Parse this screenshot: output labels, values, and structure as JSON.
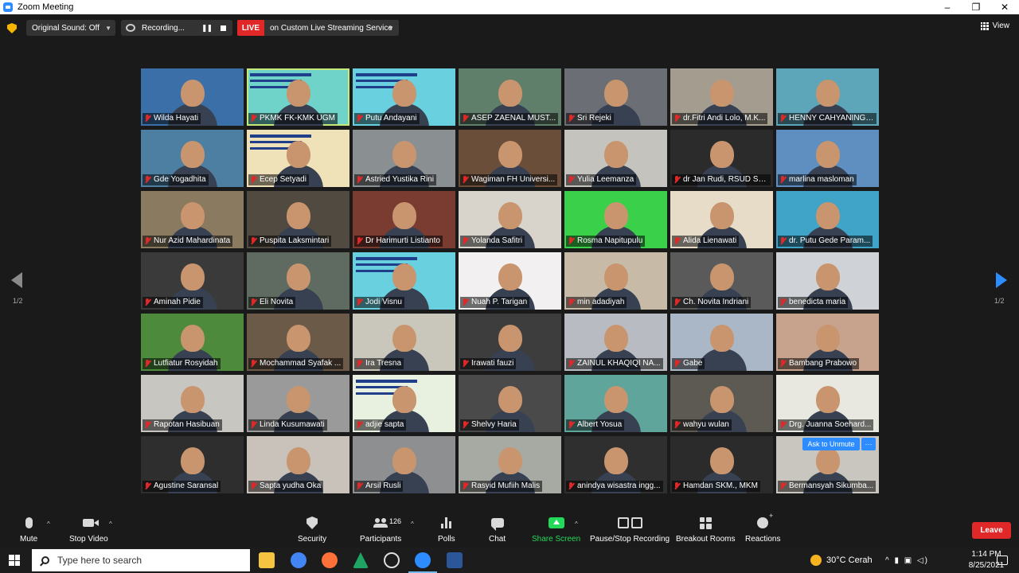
{
  "window": {
    "title": "Zoom Meeting",
    "minimize": "–",
    "restore": "❐",
    "close": "✕"
  },
  "topbar": {
    "original_sound": "Original Sound: Off",
    "recording": "Recording...",
    "live_badge": "LIVE",
    "live_service": "on Custom Live Streaming Service",
    "view": "View"
  },
  "gallery": {
    "page_left": "1/2",
    "page_right": "1/2",
    "ask_to_unmute": "Ask to Unmute",
    "more": "···",
    "participants": [
      {
        "name": "Wilda Hayati",
        "bg": "#3a6fa8"
      },
      {
        "name": "PKMK FK-KMK UGM",
        "bg": "#6fd3c9"
      },
      {
        "name": "Putu Andayani",
        "bg": "#69d0e0"
      },
      {
        "name": "ASEP ZAENAL MUST...",
        "bg": "#5f7f6a"
      },
      {
        "name": "Sri Rejeki",
        "bg": "#6b6f75"
      },
      {
        "name": "dr.Fitri Andi Lolo, M.K...",
        "bg": "#a39c8f"
      },
      {
        "name": "HENNY CAHYANINGS...",
        "bg": "#5da5b8"
      },
      {
        "name": "Gde Yogadhita",
        "bg": "#4d7fa3"
      },
      {
        "name": "Ecep Setyadi",
        "bg": "#f0e2b8"
      },
      {
        "name": "Astried Yustika Rini",
        "bg": "#8a8f92"
      },
      {
        "name": "Wagiman FH Universi...",
        "bg": "#6a4e3a"
      },
      {
        "name": "Yulia Leemanza",
        "bg": "#c5c3be"
      },
      {
        "name": "dr Jan Rudi, RSUD Su...",
        "bg": "#2b2b2b"
      },
      {
        "name": "marlina masloman",
        "bg": "#5e8fc0"
      },
      {
        "name": "Nur Azid Mahardinata",
        "bg": "#8a7a60"
      },
      {
        "name": "Puspita Laksmintari",
        "bg": "#514a40"
      },
      {
        "name": "Dr Harimurti Listianto",
        "bg": "#7a3b30"
      },
      {
        "name": "Yolanda Safitri",
        "bg": "#d8d4cc"
      },
      {
        "name": "Rosma Napitupulu",
        "bg": "#3bd04a"
      },
      {
        "name": "Alida Lienawati",
        "bg": "#e6dcc8"
      },
      {
        "name": "dr. Putu Gede Param...",
        "bg": "#3fa4c8"
      },
      {
        "name": "Aminah Pidie",
        "bg": "#3a3a3a"
      },
      {
        "name": "Eli Novita",
        "bg": "#5f6a60"
      },
      {
        "name": "Jodi Visnu",
        "bg": "#69d0e0"
      },
      {
        "name": "Nuah P. Tarigan",
        "bg": "#f2f0f0"
      },
      {
        "name": "min adadiyah",
        "bg": "#c7bba8"
      },
      {
        "name": "Ch. Novita Indriani",
        "bg": "#5a5a5a"
      },
      {
        "name": "benedicta maria",
        "bg": "#cfd3d8"
      },
      {
        "name": "Lutfiatur Rosyidah",
        "bg": "#4e8a3c"
      },
      {
        "name": "Mochammad Syafak ...",
        "bg": "#6c5a48"
      },
      {
        "name": "Ira Tresna",
        "bg": "#c9c7bc"
      },
      {
        "name": "Irawati fauzi",
        "bg": "#3d3d3d"
      },
      {
        "name": "ZAINUL KHAQIQI NA...",
        "bg": "#b8bcc2"
      },
      {
        "name": "Gabe",
        "bg": "#aab7c6"
      },
      {
        "name": "Bambang Prabowo",
        "bg": "#c7a28c"
      },
      {
        "name": "Rapotan Hasibuan",
        "bg": "#c8c6c0"
      },
      {
        "name": "Linda Kusumawati",
        "bg": "#9a9a9a"
      },
      {
        "name": "adjie sapta",
        "bg": "#e8f0e0"
      },
      {
        "name": "Shelvy Haria",
        "bg": "#4a4a4a"
      },
      {
        "name": "Albert Yosua",
        "bg": "#5fa59c"
      },
      {
        "name": "wahyu wulan",
        "bg": "#5c5a52"
      },
      {
        "name": "Drg. Juanna Soehard...",
        "bg": "#e8e8e0"
      },
      {
        "name": "Agustine Saransal",
        "bg": "#2e2e2e"
      },
      {
        "name": "Sapta yudha Oka",
        "bg": "#c8c2bb"
      },
      {
        "name": "Arsil Rusli",
        "bg": "#8d8f90"
      },
      {
        "name": "Rasyid Mufiih Malis",
        "bg": "#a7a9a3"
      },
      {
        "name": "anindya wisastra ingg...",
        "bg": "#2f2f2f"
      },
      {
        "name": "Hamdan SKM., MKM",
        "bg": "#2b2b2b"
      },
      {
        "name": "Bermansyah Sikumba...",
        "bg": "#c9c5bf"
      }
    ]
  },
  "toolbar": {
    "mute": "Mute",
    "stop_video": "Stop Video",
    "security": "Security",
    "participants": "Participants",
    "participant_count": "126",
    "polls": "Polls",
    "chat": "Chat",
    "share_screen": "Share Screen",
    "pause_stop_recording": "Pause/Stop Recording",
    "breakout_rooms": "Breakout Rooms",
    "reactions": "Reactions",
    "leave": "Leave",
    "caret": "^"
  },
  "taskbar": {
    "search_placeholder": "Type here to search",
    "weather": "30°C  Cerah",
    "time": "1:14 PM",
    "date": "8/25/2021",
    "tray_icons": "^  ▮  ▣  ◁)"
  }
}
